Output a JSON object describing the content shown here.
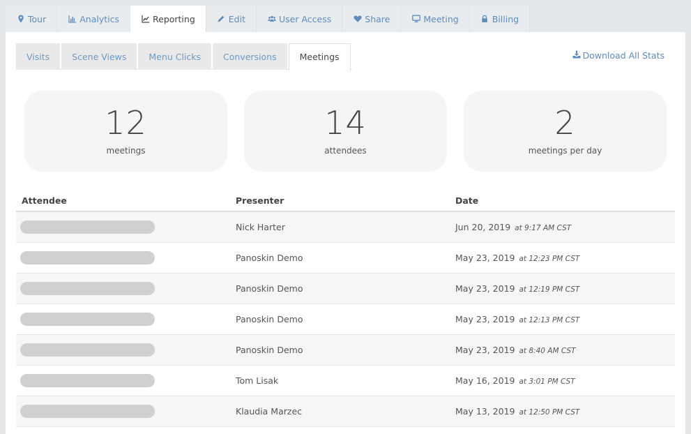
{
  "top_tabs": [
    {
      "label": "Tour",
      "icon": "map-marker-icon",
      "active": false
    },
    {
      "label": "Analytics",
      "icon": "bar-chart-icon",
      "active": false
    },
    {
      "label": "Reporting",
      "icon": "line-chart-icon",
      "active": true
    },
    {
      "label": "Edit",
      "icon": "pencil-icon",
      "active": false
    },
    {
      "label": "User Access",
      "icon": "users-icon",
      "active": false
    },
    {
      "label": "Share",
      "icon": "heart-icon",
      "active": false
    },
    {
      "label": "Meeting",
      "icon": "monitor-icon",
      "active": false
    },
    {
      "label": "Billing",
      "icon": "lock-icon",
      "active": false
    }
  ],
  "sub_tabs": [
    {
      "label": "Visits",
      "active": false
    },
    {
      "label": "Scene Views",
      "active": false
    },
    {
      "label": "Menu Clicks",
      "active": false
    },
    {
      "label": "Conversions",
      "active": false
    },
    {
      "label": "Meetings",
      "active": true
    }
  ],
  "download": {
    "label": "Download All Stats",
    "icon": "download-icon"
  },
  "stats": [
    {
      "value": "12",
      "label": "meetings"
    },
    {
      "value": "14",
      "label": "attendees"
    },
    {
      "value": "2",
      "label": "meetings per day"
    }
  ],
  "table": {
    "headers": {
      "attendee": "Attendee",
      "presenter": "Presenter",
      "date": "Date"
    },
    "rows": [
      {
        "attendee": "",
        "presenter": "Nick Harter",
        "date": "Jun 20, 2019",
        "time": "at 9:17 AM CST"
      },
      {
        "attendee": "",
        "presenter": "Panoskin Demo",
        "date": "May 23, 2019",
        "time": "at 12:23 PM CST"
      },
      {
        "attendee": "",
        "presenter": "Panoskin Demo",
        "date": "May 23, 2019",
        "time": "at 12:19 PM CST"
      },
      {
        "attendee": "",
        "presenter": "Panoskin Demo",
        "date": "May 23, 2019",
        "time": "at 12:13 PM CST"
      },
      {
        "attendee": "",
        "presenter": "Panoskin Demo",
        "date": "May 23, 2019",
        "time": "at 8:40 AM CST"
      },
      {
        "attendee": "",
        "presenter": "Tom Lisak",
        "date": "May 16, 2019",
        "time": "at 3:01 PM CST"
      },
      {
        "attendee": "",
        "presenter": "Klaudia Marzec",
        "date": "May 13, 2019",
        "time": "at 12:50 PM CST"
      }
    ]
  },
  "colors": {
    "link": "#5c8cc0",
    "redacted": "#d0d0d0",
    "card_bg": "#f5f5f5"
  }
}
